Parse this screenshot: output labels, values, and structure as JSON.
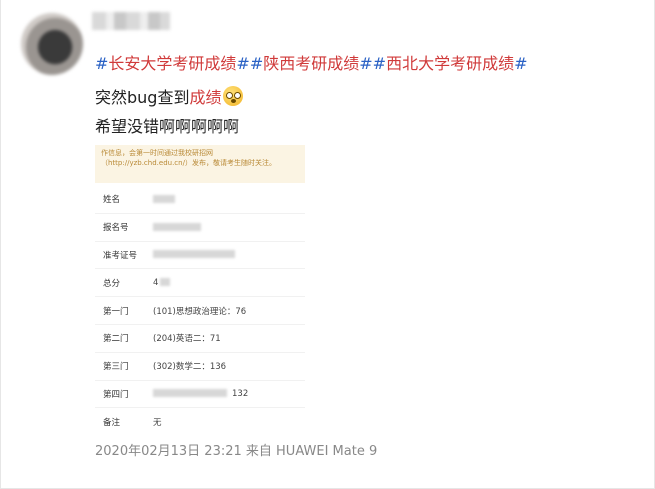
{
  "post": {
    "hashtags": [
      {
        "parts": [
          {
            "t": "#",
            "c": "tag"
          },
          {
            "t": "长安大学考研成绩",
            "c": "red"
          },
          {
            "t": "#",
            "c": "tag"
          }
        ]
      },
      {
        "parts": [
          {
            "t": "#",
            "c": "tag"
          },
          {
            "t": "陕西考研成绩",
            "c": "red"
          },
          {
            "t": "#",
            "c": "tag"
          }
        ]
      },
      {
        "parts": [
          {
            "t": "#",
            "c": "tag"
          },
          {
            "t": "西北大学考研成绩",
            "c": "red"
          },
          {
            "t": "#",
            "c": "tag"
          }
        ]
      }
    ],
    "line1_prefix": "突然bug查到",
    "line1_highlight": "成绩",
    "line1_emoji": "astonished-face",
    "line2": "希望没错啊啊啊啊啊",
    "meta": "2020年02月13日 23:21  来自 HUAWEI Mate 9"
  },
  "card": {
    "notice": "作信息，会第一时间通过我校研招网（http://yzb.chd.edu.cn/）发布，敬请考生随时关注。",
    "rows": [
      {
        "label": "姓名",
        "value": ""
      },
      {
        "label": "报名号",
        "value": ""
      },
      {
        "label": "准考证号",
        "value": ""
      },
      {
        "label": "总分",
        "value": "4"
      },
      {
        "label": "第一门",
        "value": "(101)思想政治理论：76"
      },
      {
        "label": "第二门",
        "value": "(204)英语二：71"
      },
      {
        "label": "第三门",
        "value": "(302)数学二：136"
      },
      {
        "label": "第四门",
        "value": "132"
      },
      {
        "label": "备注",
        "value": "无"
      }
    ]
  },
  "colors": {
    "hashtag": "#2b62c5",
    "highlight": "#d03a3a",
    "notice_bg": "#fbf4e3",
    "meta": "#888888"
  }
}
